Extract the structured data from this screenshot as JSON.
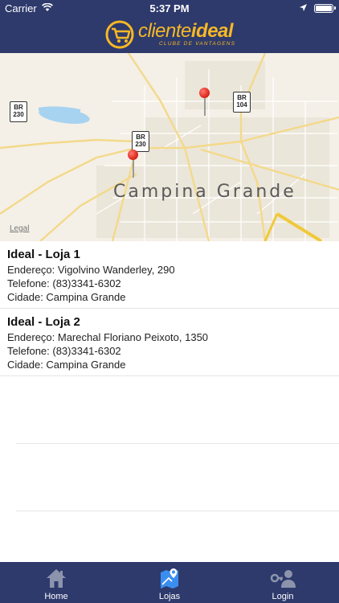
{
  "status": {
    "carrier": "Carrier",
    "time": "5:37 PM"
  },
  "header": {
    "brand_light": "cliente",
    "brand_bold": "ideal",
    "tagline": "CLUBE DE VANTAGENS"
  },
  "map": {
    "city": "Campina Grande",
    "legal": "Legal",
    "shields": [
      "BR 230",
      "BR 230",
      "BR 104"
    ]
  },
  "stores": [
    {
      "name": "Ideal - Loja 1",
      "address": "Endereço: Vigolvino Wanderley, 290",
      "phone": "Telefone: (83)3341-6302",
      "city": "Cidade: Campina Grande"
    },
    {
      "name": "Ideal - Loja 2",
      "address": "Endereço: Marechal Floriano Peixoto, 1350",
      "phone": "Telefone: (83)3341-6302",
      "city": "Cidade: Campina Grande"
    }
  ],
  "tabs": [
    {
      "label": "Home",
      "icon": "home-icon",
      "color": "#8c94ad"
    },
    {
      "label": "Lojas",
      "icon": "map-pin-icon",
      "color": "#3b8ef0"
    },
    {
      "label": "Login",
      "icon": "user-key-icon",
      "color": "#8c94ad"
    }
  ],
  "colors": {
    "navy": "#2e3a6c",
    "brand_yellow": "#f6b825",
    "active_tab": "#3b8ef0"
  }
}
